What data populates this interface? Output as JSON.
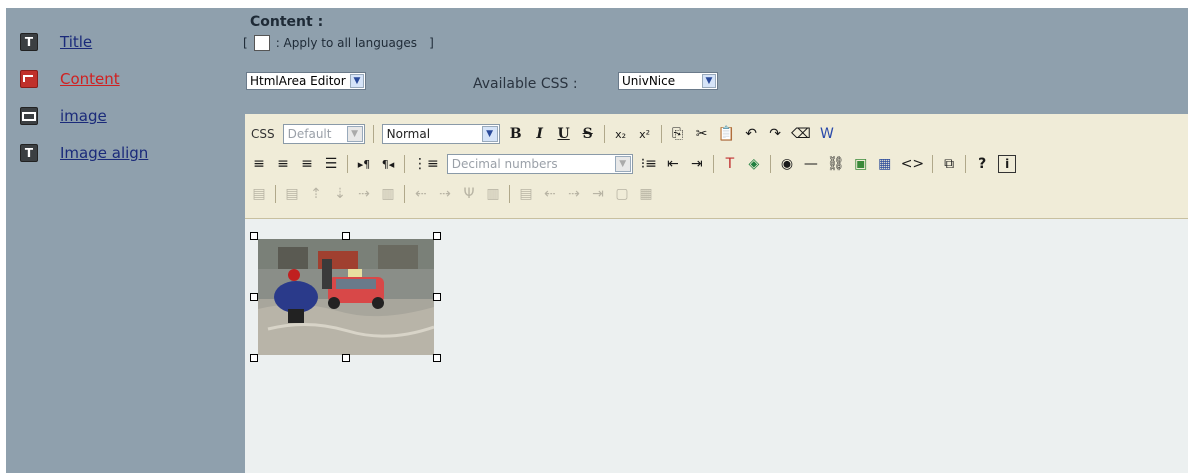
{
  "sidebar": {
    "items": [
      {
        "label": "Title",
        "icon": "text-field-icon",
        "glyph": "T",
        "active": false
      },
      {
        "label": "Content",
        "icon": "richtext-field-icon",
        "glyph": "",
        "active": true
      },
      {
        "label": "image",
        "icon": "image-field-icon",
        "glyph": "",
        "active": false
      },
      {
        "label": "Image align",
        "icon": "text-field-icon",
        "glyph": "T",
        "active": false
      }
    ]
  },
  "main": {
    "title": "Content :",
    "apply_open": "[",
    "apply_label": ": Apply to all languages",
    "apply_close": "]",
    "editor_select": "HtmlArea Editor",
    "available_css_label": "Available CSS :",
    "css_select": "UnivNice"
  },
  "toolbar": {
    "css_label": "CSS",
    "css_style": "Default",
    "format": "Normal",
    "list_style": "Decimal numbers",
    "bold": "B",
    "italic": "I",
    "underline": "U",
    "strike": "S",
    "subscript": "x₂",
    "superscript": "x²",
    "help": "?",
    "info": "i"
  },
  "colors": {
    "sidebar_bg": "#8fa0ad",
    "toolbar_bg": "#f0ecd8",
    "editor_bg": "#ecf0f0",
    "link": "#1a2a7a",
    "active_link": "#d02020"
  }
}
